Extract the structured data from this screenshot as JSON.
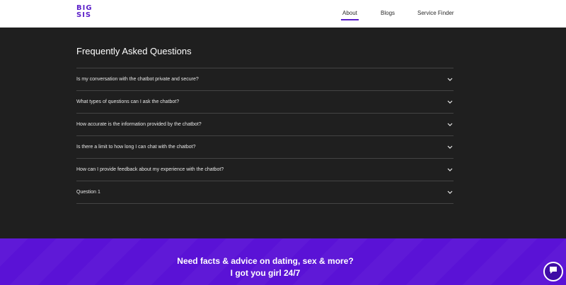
{
  "header": {
    "logo_line1": "BIG",
    "logo_line2": "SIS",
    "nav": [
      {
        "label": "About",
        "active": true
      },
      {
        "label": "Blogs",
        "active": false
      },
      {
        "label": "Service Finder",
        "active": false
      }
    ]
  },
  "faq": {
    "title": "Frequently Asked Questions",
    "items": [
      {
        "question": "Is my conversation with the chatbot private and secure?",
        "icon": "chevron-down-icon"
      },
      {
        "question": "What types of questions can I ask the chatbot?",
        "icon": "chevron-down-icon"
      },
      {
        "question": "How accurate is the information provided by the chatbot?",
        "icon": "chevron-down-icon"
      },
      {
        "question": "Is there a limit to how long I can chat with the chatbot?",
        "icon": "chevron-down-icon"
      },
      {
        "question": "How can I provide feedback about my experience with the chatbot?",
        "icon": "chevron-down-icon"
      },
      {
        "question": "Question 1",
        "icon": "chevron-down-icon"
      }
    ]
  },
  "promo": {
    "text": "Need facts & advice on dating, sex & more? I got you girl 24/7"
  },
  "chat_button": {
    "icon": "chat-bubble-icon"
  },
  "colors": {
    "brand": "#5b1fc9",
    "promo_bg": "#5a12d6",
    "faq_bg": "#1f1f1f"
  }
}
